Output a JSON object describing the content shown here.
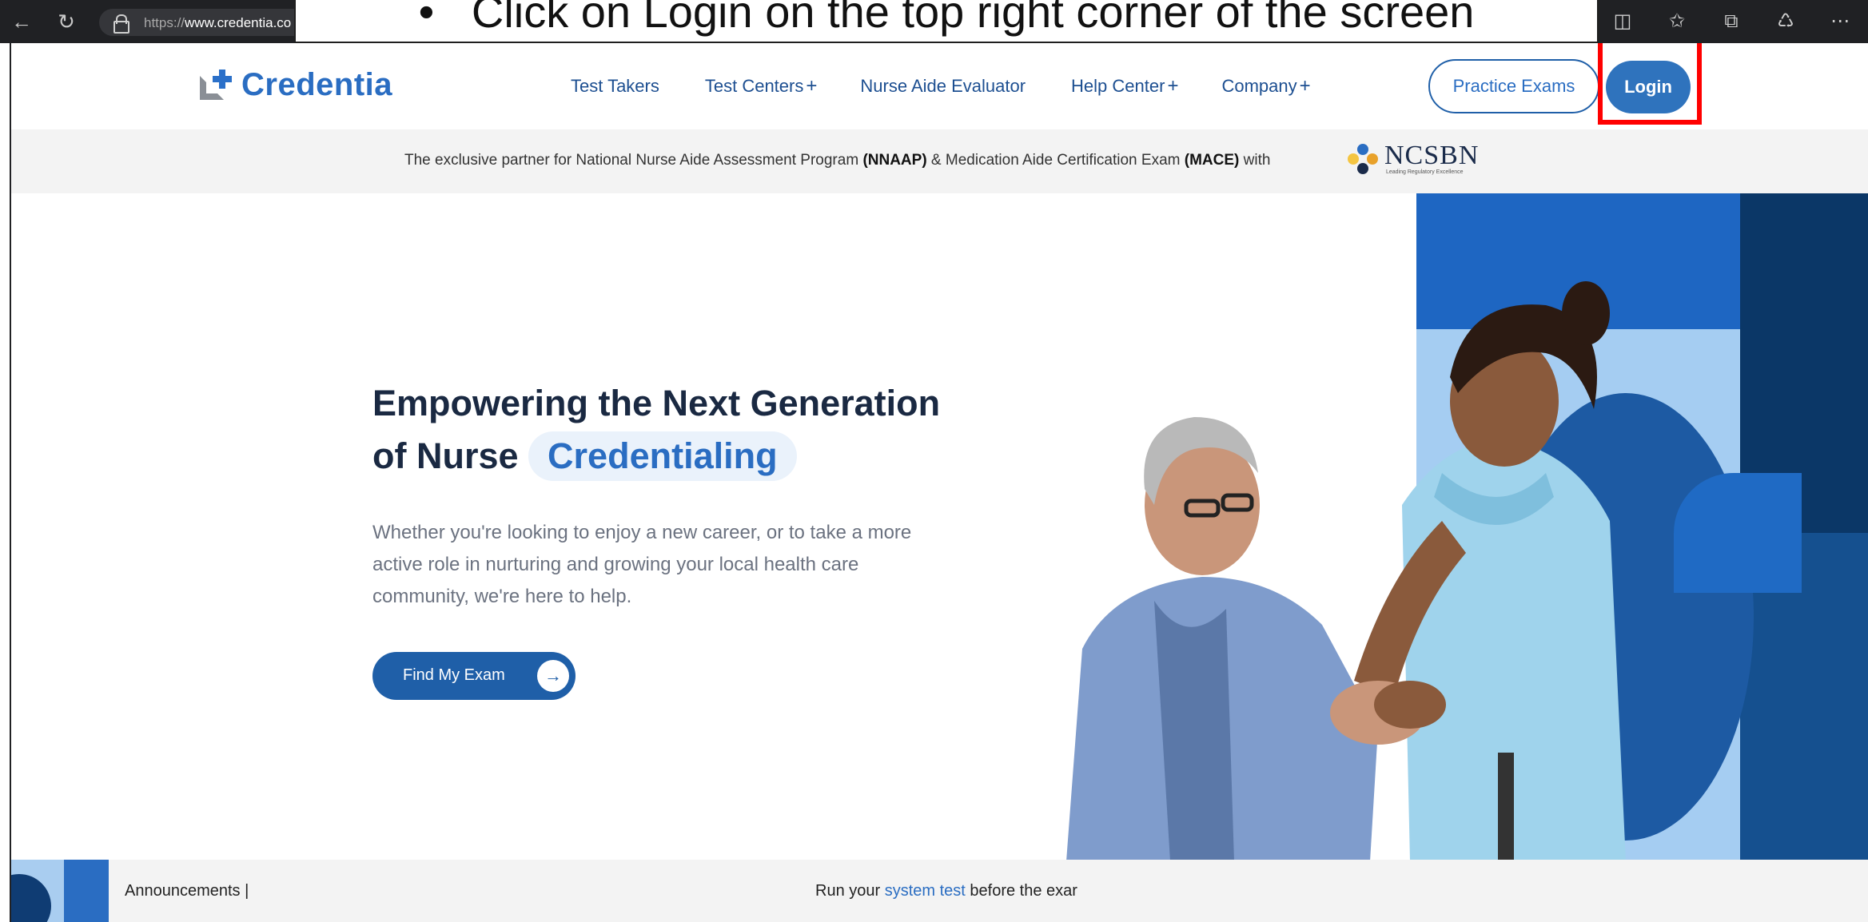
{
  "browser": {
    "url_prefix": "https://",
    "url_host": "www.credentia.co",
    "back_icon": "back-arrow-icon",
    "refresh_icon": "refresh-icon",
    "lock_icon": "lock-icon",
    "toolbar_icons": [
      "favorite-star-icon",
      "split-screen-icon",
      "favorites-icon",
      "collections-icon",
      "extensions-icon",
      "more-options-icon"
    ]
  },
  "instruction": {
    "bullet": "•",
    "text": "Click on Login on the top right corner of the screen"
  },
  "header": {
    "logo_text": "Credentia",
    "nav": [
      {
        "label": "Test Takers",
        "plus": ""
      },
      {
        "label": "Test Centers",
        "plus": "+"
      },
      {
        "label": "Nurse Aide Evaluator",
        "plus": ""
      },
      {
        "label": "Help Center",
        "plus": "+"
      },
      {
        "label": "Company",
        "plus": "+"
      }
    ],
    "practice_label": "Practice Exams",
    "login_label": "Login"
  },
  "strip": {
    "text_1": "The exclusive partner for National Nurse Aide Assessment Program ",
    "bold_1": "(NNAAP)",
    "text_2": " & Medication Aide Certification Exam ",
    "bold_2": "(MACE)",
    "text_3": " with",
    "partner_name": "NCSBN",
    "partner_tagline": "Leading Regulatory Excellence"
  },
  "hero": {
    "title_line1": "Empowering the Next Generation",
    "title_prefix": "of Nurse",
    "title_accent": "Credentialing",
    "description": "Whether you're looking to enjoy a new career, or to take a more active role in nurturing and growing your local health care community, we're here to help.",
    "cta_label": "Find My Exam",
    "cta_icon": "arrow-right-icon"
  },
  "announcements": {
    "label": "Announcements |",
    "run_prefix": "Run your ",
    "run_link": "system test",
    "run_suffix": " before the exar"
  },
  "colors": {
    "brand_blue": "#2a6dc2",
    "navy": "#1d4f91",
    "highlight": "#ff0000"
  }
}
